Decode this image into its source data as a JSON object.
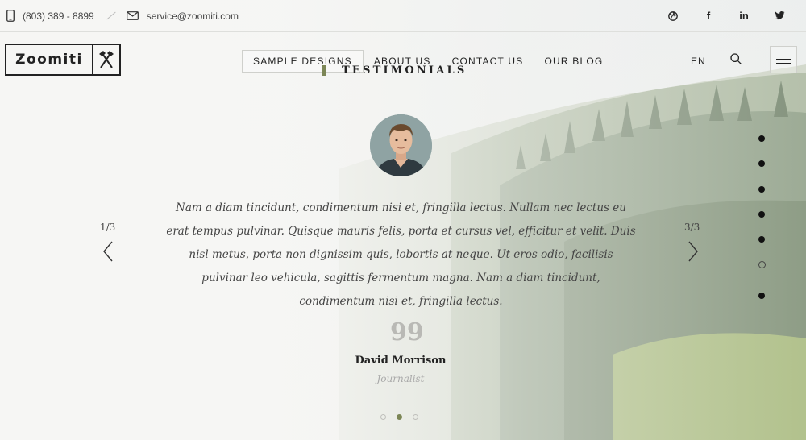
{
  "topbar": {
    "phone": "(803) 389 - 8899",
    "email": "service@zoomiti.com",
    "social_icons": [
      "dribbble-icon",
      "facebook-icon",
      "linkedin-icon",
      "twitter-icon"
    ],
    "social_labels": {
      "facebook": "f",
      "linkedin": "in"
    }
  },
  "logo": {
    "text": "Zoomiti"
  },
  "nav": {
    "items": [
      "SAMPLE DESIGNS",
      "ABOUT US",
      "CONTACT US",
      "OUR BLOG"
    ],
    "active_index": 0
  },
  "header": {
    "lang": "EN"
  },
  "section": {
    "title": "TESTIMONIALS"
  },
  "testimonial": {
    "quote": "Nam a diam tincidunt, condimentum nisi et, fringilla lectus. Nullam nec lectus eu erat tempus pulvinar. Quisque mauris felis, porta et cursus vel, efficitur et velit. Duis nisl metus, porta non dignissim quis, lobortis at neque. Ut eros odio, facilisis pulvinar leo vehicula, sagittis fermentum magna. Nam a diam tincidunt, condimentum nisi et, fringilla lectus.",
    "quote_mark": "99",
    "author": "David Morrison",
    "role": "Journalist"
  },
  "slider": {
    "prev_counter": "1/3",
    "next_counter": "3/3",
    "pager_count": 3,
    "pager_active": 1
  },
  "side_nav": {
    "count": 7,
    "active_index": 5
  },
  "colors": {
    "accent": "#7c8656",
    "text": "#222222"
  }
}
